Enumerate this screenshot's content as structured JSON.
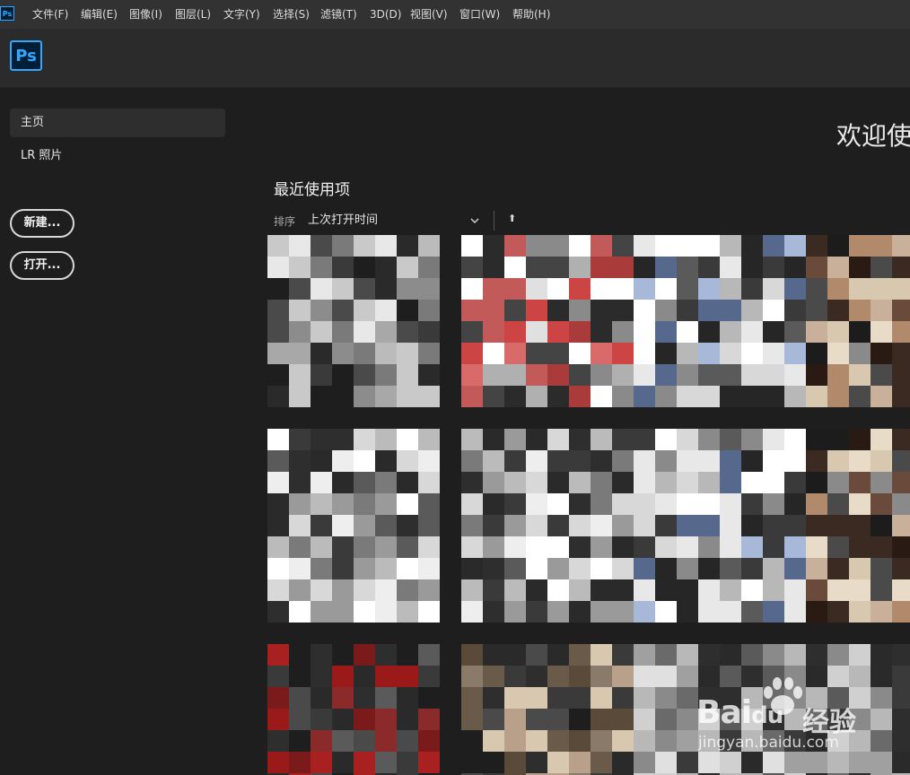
{
  "app": {
    "icon_text": "Ps",
    "logo_text": "Ps"
  },
  "menu": [
    "文件(F)",
    "编辑(E)",
    "图像(I)",
    "图层(L)",
    "文字(Y)",
    "选择(S)",
    "滤镜(T)",
    "3D(D)",
    "视图(V)",
    "窗口(W)",
    "帮助(H)"
  ],
  "sidebar": {
    "items": [
      {
        "label": "主页",
        "active": true
      },
      {
        "label": "LR 照片",
        "active": false
      }
    ],
    "new_button": "新建...",
    "open_button": "打开..."
  },
  "main": {
    "welcome": "欢迎使",
    "recent_title": "最近使用项",
    "sort_label": "排序",
    "sort_value": "上次打开时间",
    "sort_direction_icon": "⬆"
  },
  "thumbnails": [
    {
      "name": "thumb-1",
      "palette": [
        "#2a2a2a",
        "#4a4a4a",
        "#7a7a7a",
        "#a8a8a8",
        "#c9c9c9",
        "#e8e8e8",
        "#1e1e1e",
        "#3a3a3a",
        "#bbbbbb",
        "#8c8c8c"
      ]
    },
    {
      "name": "thumb-2",
      "palette": [
        "#2b2b2b",
        "#a93b3b",
        "#d86a6a",
        "#c25a5a",
        "#8a8a8a",
        "#b0b0b0",
        "#e0e0e0",
        "#ffffff",
        "#444444",
        "#cc4444"
      ]
    },
    {
      "name": "thumb-3",
      "palette": [
        "#262626",
        "#5a5a5a",
        "#8a8a8a",
        "#b8b8b8",
        "#d8d8d8",
        "#ffffff",
        "#56688c",
        "#a8b8d8",
        "#3a3a3a",
        "#e8e8e8"
      ]
    },
    {
      "name": "thumb-4",
      "palette": [
        "#1c1c1c",
        "#3a2a22",
        "#6a4a3a",
        "#c8b09a",
        "#e8dcc8",
        "#8a8a8a",
        "#2a1a14",
        "#b08a6a",
        "#4a4a4a",
        "#d8c8b0"
      ]
    },
    {
      "name": "thumb-5",
      "palette": [
        "#2a2a2a",
        "#7a1a1a",
        "#a82020",
        "#3a3a3a",
        "#5a5a5a",
        "#1e1e1e",
        "#8a2a2a",
        "#4a4a4a",
        "#2e2e2e",
        "#9a1a1a"
      ]
    },
    {
      "name": "thumb-6",
      "palette": [
        "#2a2a2a",
        "#6a5a4a",
        "#b8a08a",
        "#3a3a3a",
        "#5a4a3a",
        "#1e1e1e",
        "#8a7a6a",
        "#4a4a4a",
        "#d8c8b0",
        "#2e2e2e"
      ]
    },
    {
      "name": "thumb-7",
      "palette": [
        "#2a2a2a",
        "#9a9a9a",
        "#d8d8d8",
        "#ffffff",
        "#5a5a5a",
        "#3a3a3a",
        "#bbbbbb",
        "#7a7a7a",
        "#eeeeee",
        "#2e2e2e"
      ]
    },
    {
      "name": "thumb-8",
      "palette": [
        "#2a2a2a",
        "#8a8a8a",
        "#b8b8b8",
        "#5a5a5a",
        "#d0d0d0",
        "#3a3a3a",
        "#6a6a6a",
        "#a0a0a0",
        "#e0e0e0",
        "#2e2e2e"
      ]
    }
  ],
  "watermark": {
    "brand": "Bai",
    "brand_tail": "du",
    "cn": "经验",
    "url": "jingyan.baidu.com"
  }
}
